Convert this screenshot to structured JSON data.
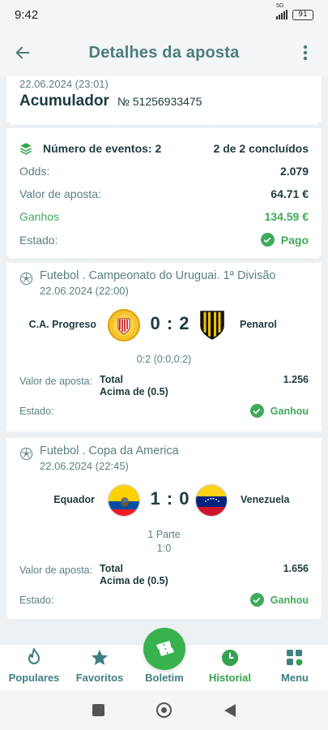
{
  "status": {
    "time": "9:42",
    "network": "5G",
    "battery": "91"
  },
  "header": {
    "title": "Detalhes da aposta"
  },
  "bet": {
    "date": "22.06.2024 (23:01)",
    "type": "Acumulador",
    "number": "№ 51256933475"
  },
  "summary": {
    "events_label": "Número de eventos: 2",
    "completed": "2 de 2 concluídos",
    "odds_label": "Odds:",
    "odds_value": "2.079",
    "stake_label": "Valor de aposta:",
    "stake_value": "64.71 €",
    "winnings_label": "Ganhos",
    "winnings_value": "134.59 €",
    "state_label": "Estado:",
    "state_value": "Pago"
  },
  "events": [
    {
      "title": "Futebol . Campeonato do Uruguai. 1ª Divisão",
      "date": "22.06.2024 (22:00)",
      "home": "C.A. Progreso",
      "away": "Penarol",
      "score": "0 : 2",
      "detail": "0:2 (0:0,0:2)",
      "detail2": "",
      "stake_label": "Valor de aposta:",
      "market": "Total",
      "selection": "Acima de (0.5)",
      "odds": "1.256",
      "state_label": "Estado:",
      "state": "Ganhou"
    },
    {
      "title": "Futebol . Copa da America",
      "date": "22.06.2024 (22:45)",
      "home": "Equador",
      "away": "Venezuela",
      "score": "1 : 0",
      "detail": "1 Parte",
      "detail2": "1:0",
      "stake_label": "Valor de aposta:",
      "market": "Total",
      "selection": "Acima de (0.5)",
      "odds": "1.656",
      "state_label": "Estado:",
      "state": "Ganhou"
    }
  ],
  "nav": {
    "popular": "Populares",
    "favorites": "Favoritos",
    "betslip": "Boletim",
    "history": "Historial",
    "menu": "Menu"
  },
  "colors": {
    "accent": "#4d7d7c",
    "green": "#3faa5a",
    "fab": "#37b24d",
    "text": "#1e3a40"
  }
}
